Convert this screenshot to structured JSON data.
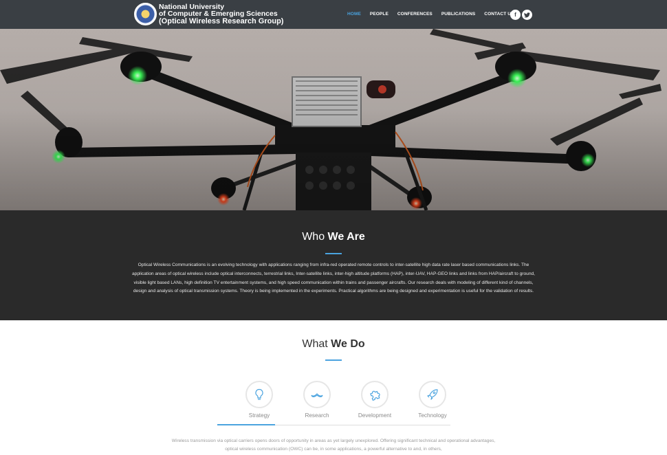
{
  "header": {
    "logo_line1": "National University",
    "logo_line2": "of Computer & Emerging Sciences",
    "logo_line3": "(Optical Wireless Research Group)",
    "nav": [
      "HOME",
      "PEOPLE",
      "CONFERENCES",
      "PUBLICATIONS",
      "CONTACT US"
    ],
    "active_nav": "HOME",
    "social": {
      "facebook": "f",
      "twitter": "t"
    }
  },
  "who": {
    "title_light": "Who ",
    "title_bold": "We Are",
    "text": "Optical Wireless Communications is an evolving technology with applications ranging from infra-red operated remote controls to inter-satellite high data rate laser based communications links. The application areas of optical wireless include optical interconnects, terrestrial links, Inter-satellite links, inter-high altitude platforms (HAP), inter-UAV, HAP-GEO links and links from HAP/aircraft to ground, visible light based LANs, high definition TV entertainment systems, and high speed communication within trains and passenger aircrafts. Our research deals with modeling of different kind of channels, design and analysis of optical transmission systems. Theory is being implemented in the experiments. Practical algorithms are being designed and experimentation is useful for the validation of results."
  },
  "what": {
    "title_light": "What ",
    "title_bold": "We Do",
    "services": [
      {
        "label": "Strategy",
        "icon": "lightbulb-icon"
      },
      {
        "label": "Research",
        "icon": "mustache-icon"
      },
      {
        "label": "Development",
        "icon": "puzzle-icon"
      },
      {
        "label": "Technology",
        "icon": "rocket-icon"
      }
    ],
    "active_service": "Strategy",
    "text": "Wireless transmission via optical carriers opens doors of opportunity in areas as yet largely unexplored. Offering significant technical and operational advantages, optical wireless communication (OWC) can be, in some applications, a powerful alternative to and, in others,"
  },
  "colors": {
    "header": "#3a3f44",
    "accent": "#4aa3df",
    "dark_section": "#2a2a2a"
  }
}
